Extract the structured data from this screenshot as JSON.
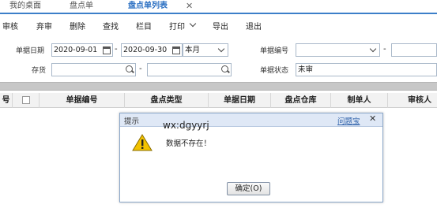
{
  "tabs": [
    {
      "label": "我的桌面"
    },
    {
      "label": "盘点单"
    },
    {
      "label": "盘点单列表",
      "active": true
    }
  ],
  "tab_close": "✕",
  "toolbar": {
    "items": [
      "审核",
      "弃审",
      "删除",
      "查找",
      "栏目",
      "打印",
      "导出",
      "退出"
    ]
  },
  "filters": {
    "date_label": "单据日期",
    "date_from": "2020-09-01",
    "date_to": "2020-09-30",
    "period": "本月",
    "dash": "-",
    "doc_no_label": "单据编号",
    "doc_no_value": "",
    "doc_no_to": "",
    "inventory_label": "存货",
    "inventory_from": "",
    "inventory_to": "",
    "status_label": "单据状态",
    "status_value": "未审"
  },
  "table": {
    "columns": [
      "号",
      "单据编号",
      "盘点类型",
      "单据日期",
      "盘点仓库",
      "制单人",
      "审核人"
    ]
  },
  "dialog": {
    "title": "提示",
    "watermark": "wx:dgyyrj",
    "link": "问题宝",
    "close": "✕",
    "message": "数据不存在！",
    "ok_label": "确定(O)"
  },
  "colors": {
    "accent": "#3c7fc9",
    "dialog_title_bg": "#dfe8f6",
    "warning": "#f2c200"
  }
}
